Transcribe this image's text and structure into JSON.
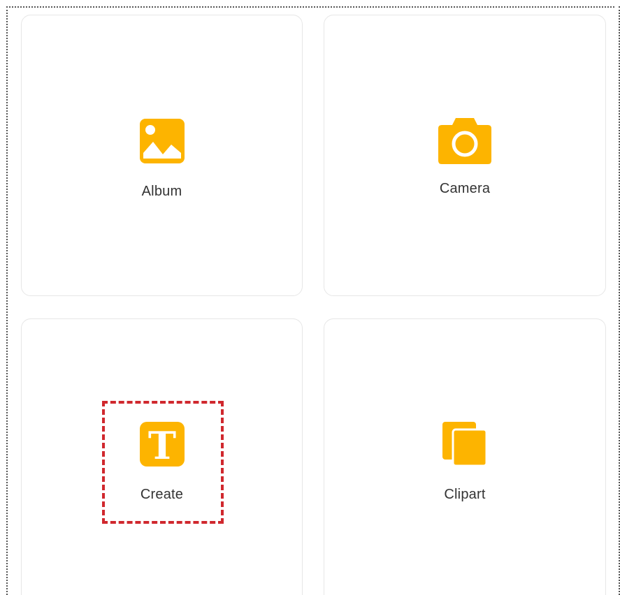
{
  "tiles": {
    "album": {
      "label": "Album",
      "icon": "image-icon"
    },
    "camera": {
      "label": "Camera",
      "icon": "camera-icon"
    },
    "create": {
      "label": "Create",
      "icon": "text-t-icon"
    },
    "clipart": {
      "label": "Clipart",
      "icon": "copy-icon"
    }
  },
  "colors": {
    "accent": "#FDB400",
    "highlight": "#D0282E",
    "label": "#333333",
    "tile_border": "#E6E6E6"
  }
}
